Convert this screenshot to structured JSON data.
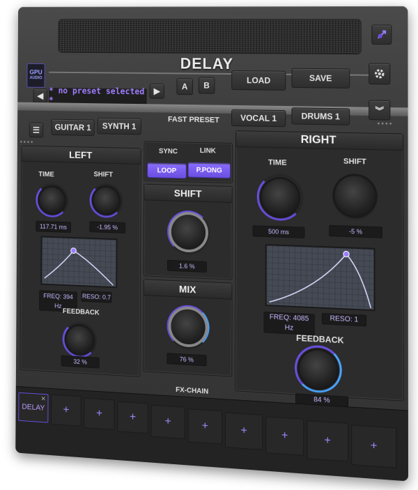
{
  "title": "DELAY",
  "logo": {
    "line1": "GPU",
    "line2": "AUDIO"
  },
  "preset": {
    "name": "* no preset selected *",
    "a_label": "A",
    "b_label": "B",
    "load_label": "LOAD",
    "save_label": "SAVE"
  },
  "fast_preset": {
    "label": "FAST PRESET",
    "items": [
      "GUITAR 1",
      "SYNTH 1",
      "VOCAL 1",
      "DRUMS 1"
    ]
  },
  "left": {
    "title": "LEFT",
    "time_label": "TIME",
    "shift_label": "SHIFT",
    "time_value": "117.71 ms",
    "shift_value": "-1.95 %",
    "freq_value": "FREQ: 394 Hz",
    "reso_value": "RESO: 0.7",
    "feedback_label": "FEEDBACK",
    "feedback_value": "32 %"
  },
  "center": {
    "sync_label": "SYNC",
    "link_label": "LINK",
    "loop_label": "LOOP",
    "ppong_label": "P.PONG",
    "shift_title": "SHIFT",
    "shift_value": "1.6 %",
    "mix_title": "MIX",
    "mix_value": "76 %"
  },
  "right": {
    "title": "RIGHT",
    "time_label": "TIME",
    "shift_label": "SHIFT",
    "time_value": "500 ms",
    "shift_value": "-5 %",
    "freq_value": "FREQ: 4085 Hz",
    "reso_value": "RESO: 1",
    "feedback_label": "FEEDBACK",
    "feedback_value": "84 %"
  },
  "fx_chain": {
    "label": "FX-CHAIN",
    "active_slot": "DELAY",
    "close_glyph": "✕",
    "empty_slot_glyph": "+"
  },
  "colors": {
    "accent": "#7b5cff"
  },
  "icons": [
    "plugin-icon",
    "gear-icon",
    "arrow-left-icon",
    "arrow-right-icon",
    "chevron-down-icon",
    "list-icon"
  ]
}
